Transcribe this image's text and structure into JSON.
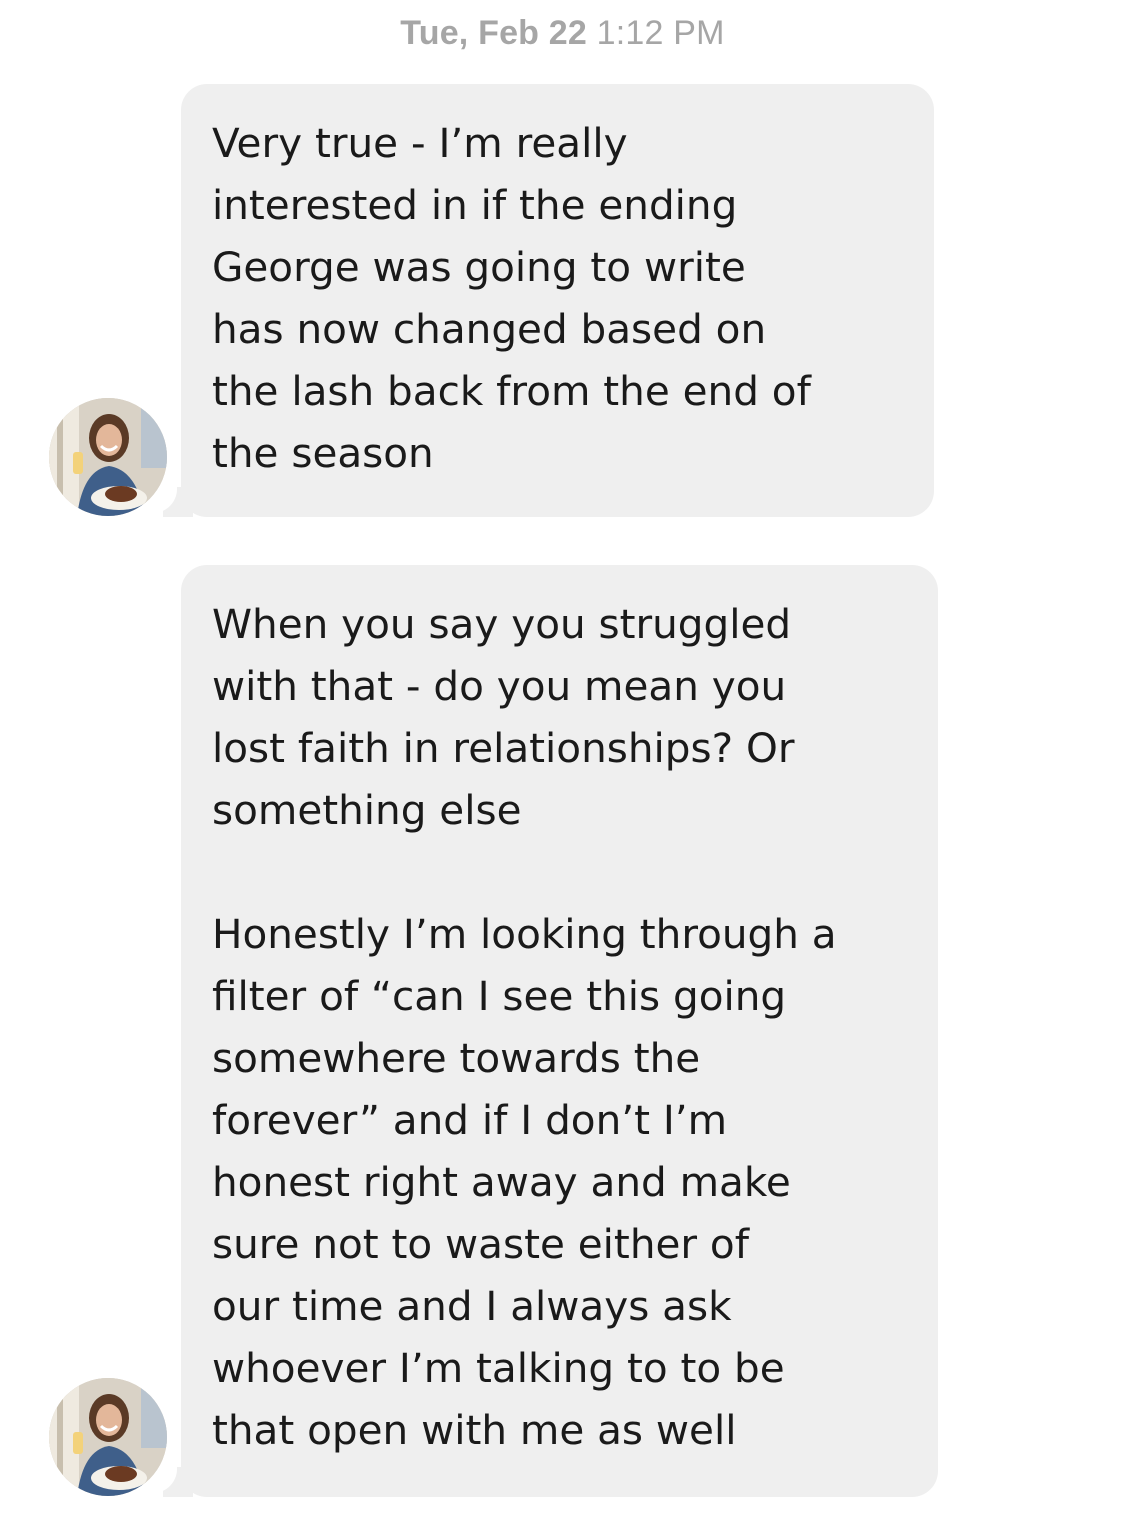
{
  "header": {
    "timestamp_day": "Tue, Feb 22",
    "timestamp_time": "1:12 PM"
  },
  "messages": [
    {
      "sender": "other",
      "text": "Very true - I’m really\ninterested in if the ending\nGeorge was going to write\nhas now changed based on\nthe lash back from the end of\nthe season"
    },
    {
      "sender": "other",
      "text": "When you say you struggled\nwith that - do you mean you\nlost faith in relationships? Or\nsomething else\n\nHonestly I’m looking through a\nfilter of “can I see this going\nsomewhere towards the\nforever” and if I don’t I’m\nhonest right away and make\nsure not to waste either of\nour time and I always ask\nwhoever I’m talking to to be\nthat open with me as well"
    }
  ],
  "icons": {
    "avatar": "profile-photo-avatar"
  },
  "colors": {
    "bubble_bg": "#efefef",
    "timestamp": "#a6a6a6",
    "text": "#1a1a1a"
  }
}
